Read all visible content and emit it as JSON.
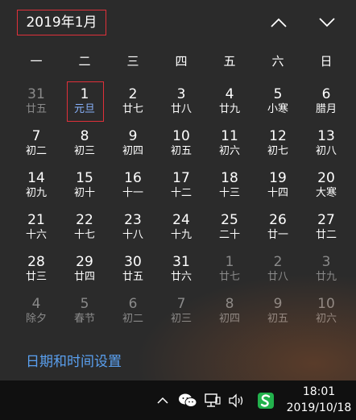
{
  "header": {
    "month_label": "2019年1月"
  },
  "weekdays": [
    "一",
    "二",
    "三",
    "四",
    "五",
    "六",
    "日"
  ],
  "days": [
    {
      "num": "31",
      "lunar": "廿五",
      "other": true
    },
    {
      "num": "1",
      "lunar": "元旦",
      "selected": true
    },
    {
      "num": "2",
      "lunar": "廿七"
    },
    {
      "num": "3",
      "lunar": "廿八"
    },
    {
      "num": "4",
      "lunar": "廿九"
    },
    {
      "num": "5",
      "lunar": "小寒"
    },
    {
      "num": "6",
      "lunar": "腊月"
    },
    {
      "num": "7",
      "lunar": "初二"
    },
    {
      "num": "8",
      "lunar": "初三"
    },
    {
      "num": "9",
      "lunar": "初四"
    },
    {
      "num": "10",
      "lunar": "初五"
    },
    {
      "num": "11",
      "lunar": "初六"
    },
    {
      "num": "12",
      "lunar": "初七"
    },
    {
      "num": "13",
      "lunar": "初八"
    },
    {
      "num": "14",
      "lunar": "初九"
    },
    {
      "num": "15",
      "lunar": "初十"
    },
    {
      "num": "16",
      "lunar": "十一"
    },
    {
      "num": "17",
      "lunar": "十二"
    },
    {
      "num": "18",
      "lunar": "十三"
    },
    {
      "num": "19",
      "lunar": "十四"
    },
    {
      "num": "20",
      "lunar": "大寒"
    },
    {
      "num": "21",
      "lunar": "十六"
    },
    {
      "num": "22",
      "lunar": "十七"
    },
    {
      "num": "23",
      "lunar": "十八"
    },
    {
      "num": "24",
      "lunar": "十九"
    },
    {
      "num": "25",
      "lunar": "二十"
    },
    {
      "num": "26",
      "lunar": "廿一"
    },
    {
      "num": "27",
      "lunar": "廿二"
    },
    {
      "num": "28",
      "lunar": "廿三"
    },
    {
      "num": "29",
      "lunar": "廿四"
    },
    {
      "num": "30",
      "lunar": "廿五"
    },
    {
      "num": "31",
      "lunar": "廿六"
    },
    {
      "num": "1",
      "lunar": "廿七",
      "other": true
    },
    {
      "num": "2",
      "lunar": "廿八",
      "other": true
    },
    {
      "num": "3",
      "lunar": "廿九",
      "other": true
    },
    {
      "num": "4",
      "lunar": "除夕",
      "other": true
    },
    {
      "num": "5",
      "lunar": "春节",
      "other": true
    },
    {
      "num": "6",
      "lunar": "初二",
      "other": true
    },
    {
      "num": "7",
      "lunar": "初三",
      "other": true
    },
    {
      "num": "8",
      "lunar": "初四",
      "other": true
    },
    {
      "num": "9",
      "lunar": "初五",
      "other": true
    },
    {
      "num": "10",
      "lunar": "初六",
      "other": true
    }
  ],
  "footer": {
    "settings_link": "日期和时间设置"
  },
  "taskbar": {
    "time": "18:01",
    "date": "2019/10/18",
    "icons": [
      "chevron-up-icon",
      "wechat-icon",
      "network-icon",
      "volume-icon",
      "sogou-input-icon"
    ]
  },
  "colors": {
    "background": "#2b2b2b",
    "selection_border": "#e0303a",
    "link": "#5aa0f0",
    "muted": "#8a8a8a",
    "taskbar": "#101010"
  }
}
